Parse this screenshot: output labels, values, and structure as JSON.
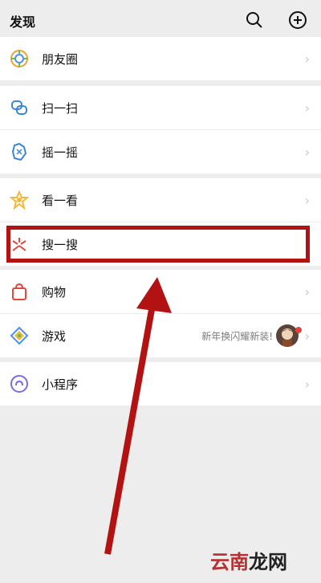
{
  "header": {
    "title": "发现"
  },
  "groups": {
    "moments": {
      "label": "朋友圈"
    },
    "scan": {
      "label": "扫一扫"
    },
    "shake": {
      "label": "摇一摇"
    },
    "look": {
      "label": "看一看"
    },
    "search": {
      "label": "搜一搜"
    },
    "shop": {
      "label": "购物"
    },
    "games": {
      "label": "游戏",
      "note": "新年换闪耀新装!"
    },
    "miniprogram": {
      "label": "小程序"
    }
  },
  "watermark": {
    "part1": "云南",
    "part2": "龙网"
  },
  "colors": {
    "highlight": "#b31212",
    "badge": "#e64340"
  }
}
